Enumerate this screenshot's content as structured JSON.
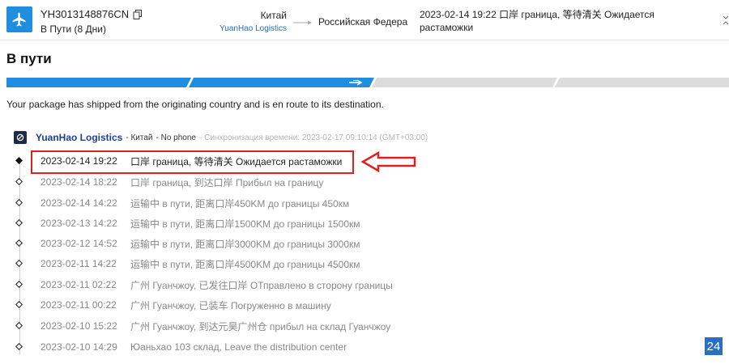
{
  "header": {
    "tracking_number": "YH3013148876CN",
    "status": "В Пути (8 Дни)",
    "origin_country": "Китай",
    "carrier_link": "YuanHao Logistics",
    "destination_country": "Российская Федерация",
    "last_event": "2023-02-14 19:22 口岸 граница, 等待清关 Ожидается растаможки",
    "icons": [
      "airplane-icon",
      "copy-icon",
      "route-arrow-icon",
      "collapse-icon"
    ]
  },
  "section_title": "В пути",
  "progress": {
    "filled_fraction": 0.5,
    "segments": 4,
    "accent_color": "#1f8de0"
  },
  "shipped_message": "Your package has shipped from the originating country and is en route to its destination.",
  "carrier": {
    "name": "YuanHao Logistics",
    "country": "- Китай",
    "phone": "- No phone",
    "sync": "- Синхронизация времени: 2023-02-17 09:10:14 (GMT+03:00)"
  },
  "events": [
    {
      "date": "2023-02-14 19:22",
      "description": "口岸 граница, 等待清关 Ожидается растаможки"
    },
    {
      "date": "2023-02-14 18:22",
      "description": "口岸 граница, 到达口岸 Прибыл на границу"
    },
    {
      "date": "2023-02-14 14:22",
      "description": "运输中 в пути, 距离口岸450KM до границы 450км"
    },
    {
      "date": "2023-02-13 14:22",
      "description": "运输中 в пути, 距离口岸1500KM до границы 1500км"
    },
    {
      "date": "2023-02-12 14:52",
      "description": "运输中 в пути, 距离口岸3000KM до границы 3000км"
    },
    {
      "date": "2023-02-11 14:22",
      "description": "运输中 в пути, 距离口岸4500KM до границы 4500км"
    },
    {
      "date": "2023-02-11 02:22",
      "description": "广州 Гуанчжоу, 已发往口岸 ОТправлено в сторону границы"
    },
    {
      "date": "2023-02-11 00:22",
      "description": "广州 Гуанчжоу, 已装车 Погруженно в машину"
    },
    {
      "date": "2023-02-10 15:22",
      "description": "广州 Гуанчжоу, 到达元昊广州仓 прибыл на склад Гуанчжоу"
    },
    {
      "date": "2023-02-10 14:29",
      "description": "Юаньхао 103 склад, Leave the distribution center"
    }
  ],
  "badge": "24",
  "colors": {
    "highlight": "#e02020",
    "carrier_name": "#1f3f8f",
    "link": "#1f6fc0"
  }
}
